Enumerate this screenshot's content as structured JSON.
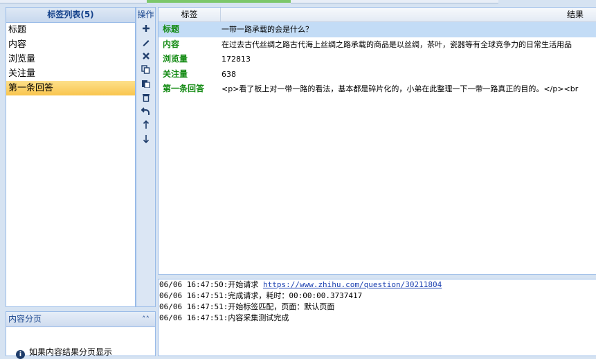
{
  "tag_list": {
    "title": "标签列表(5)",
    "items": [
      "标题",
      "内容",
      "浏览量",
      "关注量",
      "第一条回答"
    ],
    "selected_index": 4
  },
  "ops": {
    "title": "操作",
    "buttons": [
      "add-icon",
      "edit-icon",
      "delete-icon",
      "copy-icon",
      "paste-icon",
      "trash-icon",
      "undo-icon",
      "move-up-icon",
      "move-down-icon"
    ]
  },
  "paging": {
    "title": "内容分页",
    "info": "如果内容结果分页显示"
  },
  "grid": {
    "col_tag": "标签",
    "col_result": "结果",
    "rows": [
      {
        "tag": "标题",
        "value": "一带一路承载的会是什么？"
      },
      {
        "tag": "内容",
        "value": "在过去古代丝绸之路古代海上丝绸之路承载的商品是以丝绸，茶叶，瓷器等有全球竞争力的日常生活用品"
      },
      {
        "tag": "浏览量",
        "value": "172813"
      },
      {
        "tag": "关注量",
        "value": "638"
      },
      {
        "tag": "第一条回答",
        "value": "<p>看了板上对一带一路的看法，基本都是碎片化的，小弟在此整理一下一带一路真正的目的。</p><br"
      }
    ]
  },
  "log": {
    "lines": [
      {
        "text": "06/06 16:47:50:开始请求 ",
        "link": "https://www.zhihu.com/question/30211804"
      },
      {
        "text": "06/06 16:47:51:完成请求，耗时：00:00:00.3737417",
        "link": ""
      },
      {
        "text": "06/06 16:47:51:开始标签匹配，页面：默认页面",
        "link": ""
      },
      {
        "text": "06/06 16:47:51:内容采集测试完成",
        "link": ""
      }
    ]
  },
  "colors": {
    "tag_key": "#128a12",
    "selection": "#f9c54e",
    "row_selection": "#c3dcf6",
    "link": "#1a3fb0"
  }
}
